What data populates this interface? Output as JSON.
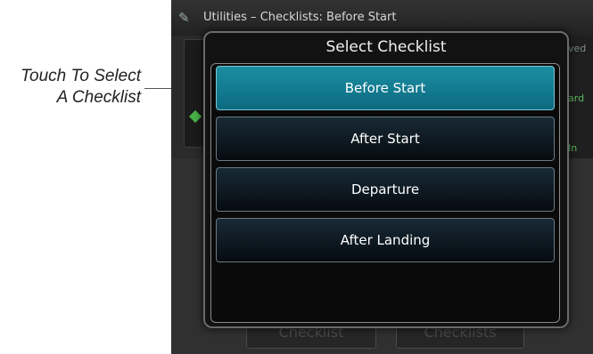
{
  "callout": {
    "line1": "Touch To Select",
    "line2": "A Checklist"
  },
  "title_bar": {
    "icon": "checklist-icon",
    "text": "Utilities – Checklists: Before Start"
  },
  "background": {
    "right_labels": [
      "ved",
      "ard",
      "In"
    ],
    "bottom_buttons": [
      "Checklist",
      "Checklists"
    ]
  },
  "dialog": {
    "title": "Select Checklist",
    "items": [
      {
        "label": "Before Start",
        "selected": true
      },
      {
        "label": "After Start",
        "selected": false
      },
      {
        "label": "Departure",
        "selected": false
      },
      {
        "label": "After Landing",
        "selected": false
      }
    ]
  },
  "colors": {
    "selected_item": "#1b8ea3",
    "item_background": "#060b10",
    "screen_background": "#2a2a2a"
  }
}
